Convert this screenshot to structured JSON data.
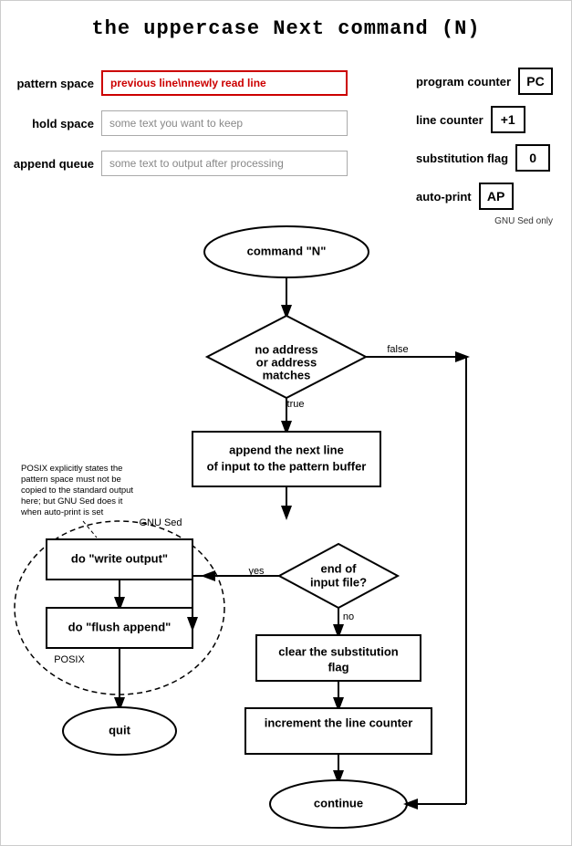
{
  "title": "the uppercase Next command (N)",
  "registers": {
    "pattern_space_label": "pattern space",
    "pattern_space_value": "previous line\\nnewly read line",
    "hold_space_label": "hold space",
    "hold_space_value": "some text you want to keep",
    "append_queue_label": "append queue",
    "append_queue_value": "some text to output after processing"
  },
  "right_registers": {
    "program_counter_label": "program counter",
    "program_counter_value": "PC",
    "line_counter_label": "line counter",
    "line_counter_value": "+1",
    "substitution_flag_label": "substitution flag",
    "substitution_flag_value": "0",
    "auto_print_label": "auto-print",
    "auto_print_value": "AP",
    "gnu_only": "GNU Sed only"
  },
  "flowchart": {
    "command_n": "command \"N\"",
    "decision_address": "no address\nor address\nmatches",
    "false_label": "false",
    "true_label": "true",
    "append_next_line": "append the next line\nof input to the pattern buffer",
    "end_of_file": "end of\ninput file?",
    "yes_label": "yes",
    "no_label": "no",
    "clear_flag": "clear the substitution\nflag",
    "increment_counter": "increment the line counter",
    "write_output": "do \"write output\"",
    "flush_append": "do \"flush append\"",
    "quit": "quit",
    "continue": "continue",
    "gnu_sed_label": "GNU Sed",
    "posix_label": "POSIX",
    "note": "POSIX explicitly states the\npattern space must not be\ncopied to the standard output\nhere; but GNU Sed does it\nwhen auto-print is set"
  }
}
